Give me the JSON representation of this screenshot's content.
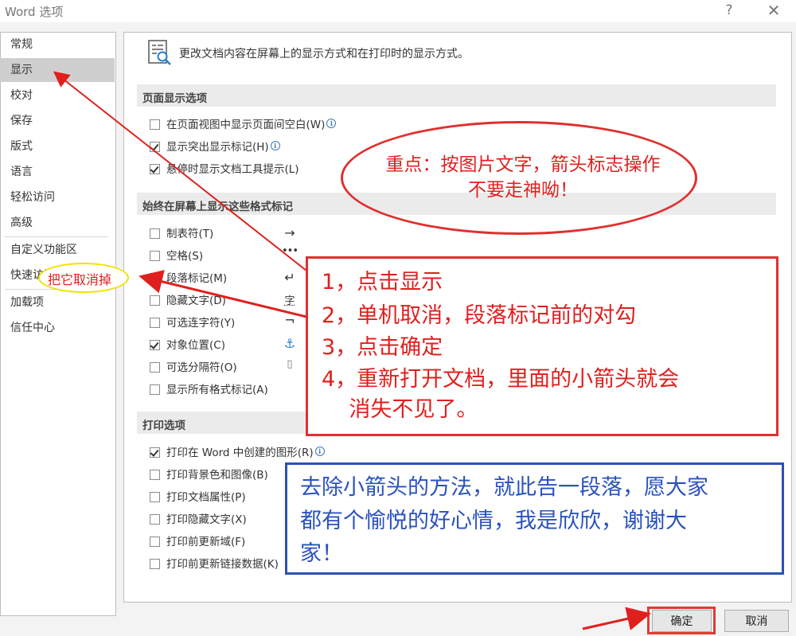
{
  "window": {
    "title": "Word 选项",
    "help_label": "?",
    "close_label": "✕"
  },
  "sidebar": {
    "items": [
      {
        "label": "常规"
      },
      {
        "label": "显示"
      },
      {
        "label": "校对"
      },
      {
        "label": "保存"
      },
      {
        "label": "版式"
      },
      {
        "label": "语言"
      },
      {
        "label": "轻松访问"
      },
      {
        "label": "高级"
      },
      {
        "label": "自定义功能区"
      },
      {
        "label": "快速访问工具栏"
      },
      {
        "label": "加载项"
      },
      {
        "label": "信任中心"
      }
    ],
    "selected_index": 1
  },
  "header": {
    "icon": "display-options-icon",
    "text": "更改文档内容在屏幕上的显示方式和在打印时的显示方式。"
  },
  "sections": {
    "page_display": {
      "title": "页面显示选项",
      "options": [
        {
          "label": "在页面视图中显示页面间空白(W)",
          "checked": false,
          "info": true
        },
        {
          "label": "显示突出显示标记(H)",
          "checked": true,
          "info": true
        },
        {
          "label": "悬停时显示文档工具提示(L)",
          "checked": true,
          "info": false
        }
      ]
    },
    "format_marks": {
      "title": "始终在屏幕上显示这些格式标记",
      "options": [
        {
          "label": "制表符(T)",
          "checked": false,
          "symbol": "→"
        },
        {
          "label": "空格(S)",
          "checked": false,
          "symbol": "•••"
        },
        {
          "label": "段落标记(M)",
          "checked": true,
          "symbol": "↵"
        },
        {
          "label": "隐藏文字(D)",
          "checked": false,
          "symbol": "字"
        },
        {
          "label": "可选连字符(Y)",
          "checked": false,
          "symbol": "¬"
        },
        {
          "label": "对象位置(C)",
          "checked": true,
          "symbol": "⚓"
        },
        {
          "label": "可选分隔符(O)",
          "checked": false,
          "symbol": "▯"
        },
        {
          "label": "显示所有格式标记(A)",
          "checked": false,
          "symbol": ""
        }
      ]
    },
    "print": {
      "title": "打印选项",
      "options": [
        {
          "label": "打印在 Word 中创建的图形(R)",
          "checked": true,
          "info": true
        },
        {
          "label": "打印背景色和图像(B)",
          "checked": false,
          "info": false
        },
        {
          "label": "打印文档属性(P)",
          "checked": false,
          "info": false
        },
        {
          "label": "打印隐藏文字(X)",
          "checked": false,
          "info": false
        },
        {
          "label": "打印前更新域(F)",
          "checked": false,
          "info": false
        },
        {
          "label": "打印前更新链接数据(K)",
          "checked": false,
          "info": false
        }
      ]
    }
  },
  "buttons": {
    "ok": "确定",
    "cancel": "取消"
  },
  "annotations": {
    "ellipse_lines": [
      "重点：按图片文字，箭头标志操作",
      "不要走神呦！"
    ],
    "steps": [
      "1，点击显示",
      "2，单机取消，段落标记前的对勾",
      "3，点击确定",
      "4，重新打开文档，里面的小箭头就会",
      "    消失不见了。"
    ],
    "closing_lines": [
      "去除小箭头的方法，就此告一段落，愿大家",
      "都有个愉悦的好心情，我是欣欣，谢谢大",
      "家！"
    ],
    "yellow_label": "把它取消掉",
    "colors": {
      "red": "#e0201e",
      "blue": "#2a52be",
      "yellow": "#f1e100"
    }
  }
}
